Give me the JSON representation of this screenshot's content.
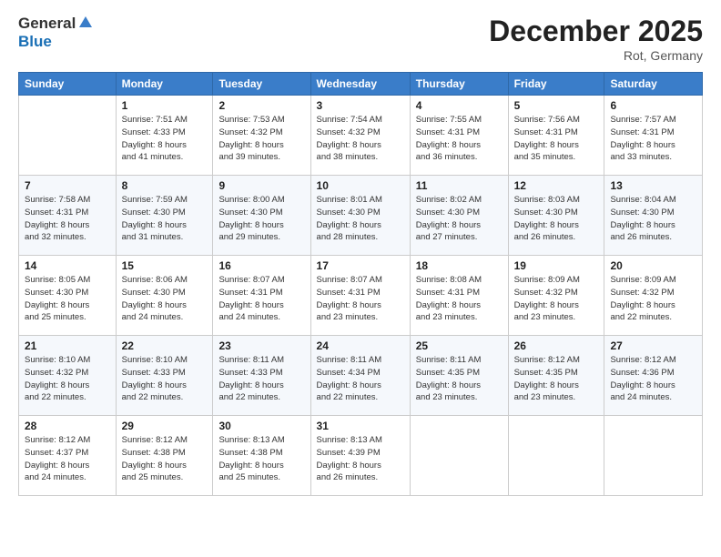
{
  "logo": {
    "line1": "General",
    "line2": "Blue"
  },
  "title": "December 2025",
  "location": "Rot, Germany",
  "weekdays": [
    "Sunday",
    "Monday",
    "Tuesday",
    "Wednesday",
    "Thursday",
    "Friday",
    "Saturday"
  ],
  "weeks": [
    [
      {
        "day": "",
        "info": ""
      },
      {
        "day": "1",
        "info": "Sunrise: 7:51 AM\nSunset: 4:33 PM\nDaylight: 8 hours\nand 41 minutes."
      },
      {
        "day": "2",
        "info": "Sunrise: 7:53 AM\nSunset: 4:32 PM\nDaylight: 8 hours\nand 39 minutes."
      },
      {
        "day": "3",
        "info": "Sunrise: 7:54 AM\nSunset: 4:32 PM\nDaylight: 8 hours\nand 38 minutes."
      },
      {
        "day": "4",
        "info": "Sunrise: 7:55 AM\nSunset: 4:31 PM\nDaylight: 8 hours\nand 36 minutes."
      },
      {
        "day": "5",
        "info": "Sunrise: 7:56 AM\nSunset: 4:31 PM\nDaylight: 8 hours\nand 35 minutes."
      },
      {
        "day": "6",
        "info": "Sunrise: 7:57 AM\nSunset: 4:31 PM\nDaylight: 8 hours\nand 33 minutes."
      }
    ],
    [
      {
        "day": "7",
        "info": "Sunrise: 7:58 AM\nSunset: 4:31 PM\nDaylight: 8 hours\nand 32 minutes."
      },
      {
        "day": "8",
        "info": "Sunrise: 7:59 AM\nSunset: 4:30 PM\nDaylight: 8 hours\nand 31 minutes."
      },
      {
        "day": "9",
        "info": "Sunrise: 8:00 AM\nSunset: 4:30 PM\nDaylight: 8 hours\nand 29 minutes."
      },
      {
        "day": "10",
        "info": "Sunrise: 8:01 AM\nSunset: 4:30 PM\nDaylight: 8 hours\nand 28 minutes."
      },
      {
        "day": "11",
        "info": "Sunrise: 8:02 AM\nSunset: 4:30 PM\nDaylight: 8 hours\nand 27 minutes."
      },
      {
        "day": "12",
        "info": "Sunrise: 8:03 AM\nSunset: 4:30 PM\nDaylight: 8 hours\nand 26 minutes."
      },
      {
        "day": "13",
        "info": "Sunrise: 8:04 AM\nSunset: 4:30 PM\nDaylight: 8 hours\nand 26 minutes."
      }
    ],
    [
      {
        "day": "14",
        "info": "Sunrise: 8:05 AM\nSunset: 4:30 PM\nDaylight: 8 hours\nand 25 minutes."
      },
      {
        "day": "15",
        "info": "Sunrise: 8:06 AM\nSunset: 4:30 PM\nDaylight: 8 hours\nand 24 minutes."
      },
      {
        "day": "16",
        "info": "Sunrise: 8:07 AM\nSunset: 4:31 PM\nDaylight: 8 hours\nand 24 minutes."
      },
      {
        "day": "17",
        "info": "Sunrise: 8:07 AM\nSunset: 4:31 PM\nDaylight: 8 hours\nand 23 minutes."
      },
      {
        "day": "18",
        "info": "Sunrise: 8:08 AM\nSunset: 4:31 PM\nDaylight: 8 hours\nand 23 minutes."
      },
      {
        "day": "19",
        "info": "Sunrise: 8:09 AM\nSunset: 4:32 PM\nDaylight: 8 hours\nand 23 minutes."
      },
      {
        "day": "20",
        "info": "Sunrise: 8:09 AM\nSunset: 4:32 PM\nDaylight: 8 hours\nand 22 minutes."
      }
    ],
    [
      {
        "day": "21",
        "info": "Sunrise: 8:10 AM\nSunset: 4:32 PM\nDaylight: 8 hours\nand 22 minutes."
      },
      {
        "day": "22",
        "info": "Sunrise: 8:10 AM\nSunset: 4:33 PM\nDaylight: 8 hours\nand 22 minutes."
      },
      {
        "day": "23",
        "info": "Sunrise: 8:11 AM\nSunset: 4:33 PM\nDaylight: 8 hours\nand 22 minutes."
      },
      {
        "day": "24",
        "info": "Sunrise: 8:11 AM\nSunset: 4:34 PM\nDaylight: 8 hours\nand 22 minutes."
      },
      {
        "day": "25",
        "info": "Sunrise: 8:11 AM\nSunset: 4:35 PM\nDaylight: 8 hours\nand 23 minutes."
      },
      {
        "day": "26",
        "info": "Sunrise: 8:12 AM\nSunset: 4:35 PM\nDaylight: 8 hours\nand 23 minutes."
      },
      {
        "day": "27",
        "info": "Sunrise: 8:12 AM\nSunset: 4:36 PM\nDaylight: 8 hours\nand 24 minutes."
      }
    ],
    [
      {
        "day": "28",
        "info": "Sunrise: 8:12 AM\nSunset: 4:37 PM\nDaylight: 8 hours\nand 24 minutes."
      },
      {
        "day": "29",
        "info": "Sunrise: 8:12 AM\nSunset: 4:38 PM\nDaylight: 8 hours\nand 25 minutes."
      },
      {
        "day": "30",
        "info": "Sunrise: 8:13 AM\nSunset: 4:38 PM\nDaylight: 8 hours\nand 25 minutes."
      },
      {
        "day": "31",
        "info": "Sunrise: 8:13 AM\nSunset: 4:39 PM\nDaylight: 8 hours\nand 26 minutes."
      },
      {
        "day": "",
        "info": ""
      },
      {
        "day": "",
        "info": ""
      },
      {
        "day": "",
        "info": ""
      }
    ]
  ]
}
